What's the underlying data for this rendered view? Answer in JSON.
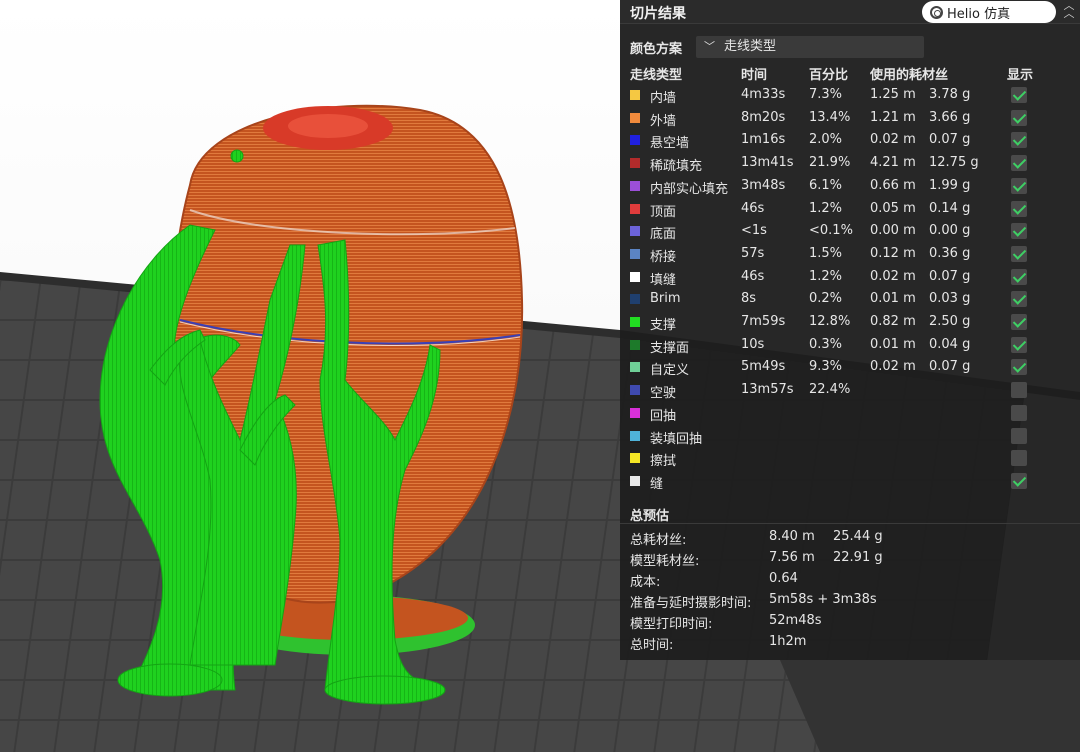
{
  "panel": {
    "title": "切片结果",
    "helio_button": "Helio 仿真",
    "color_scheme_label": "颜色方案",
    "color_scheme_value": "走线类型",
    "headers": {
      "type": "走线类型",
      "time": "时间",
      "percent": "百分比",
      "usage": "使用的耗材丝",
      "show": "显示"
    }
  },
  "legend": [
    {
      "name": "内墙",
      "color": "#f5c842",
      "time": "4m33s",
      "percent": "7.3%",
      "length": "1.25 m",
      "weight": "3.78 g",
      "checked": true
    },
    {
      "name": "外墙",
      "color": "#f08a3c",
      "time": "8m20s",
      "percent": "13.4%",
      "length": "1.21 m",
      "weight": "3.66 g",
      "checked": true
    },
    {
      "name": "悬空墙",
      "color": "#2020e0",
      "time": "1m16s",
      "percent": "2.0%",
      "length": "0.02 m",
      "weight": "0.07 g",
      "checked": true
    },
    {
      "name": "稀疏填充",
      "color": "#b22b2b",
      "time": "13m41s",
      "percent": "21.9%",
      "length": "4.21 m",
      "weight": "12.75 g",
      "checked": true
    },
    {
      "name": "内部实心填充",
      "color": "#9b4fd8",
      "time": "3m48s",
      "percent": "6.1%",
      "length": "0.66 m",
      "weight": "1.99 g",
      "checked": true
    },
    {
      "name": "顶面",
      "color": "#e03c3c",
      "time": "46s",
      "percent": "1.2%",
      "length": "0.05 m",
      "weight": "0.14 g",
      "checked": true
    },
    {
      "name": "底面",
      "color": "#6c63d9",
      "time": "<1s",
      "percent": "<0.1%",
      "length": "0.00 m",
      "weight": "0.00 g",
      "checked": true
    },
    {
      "name": "桥接",
      "color": "#5b84c4",
      "time": "57s",
      "percent": "1.5%",
      "length": "0.12 m",
      "weight": "0.36 g",
      "checked": true
    },
    {
      "name": "填缝",
      "color": "#ffffff",
      "time": "46s",
      "percent": "1.2%",
      "length": "0.02 m",
      "weight": "0.07 g",
      "checked": true
    },
    {
      "name": "Brim",
      "color": "#1f3f6e",
      "time": "8s",
      "percent": "0.2%",
      "length": "0.01 m",
      "weight": "0.03 g",
      "checked": true
    },
    {
      "name": "支撑",
      "color": "#22dd22",
      "time": "7m59s",
      "percent": "12.8%",
      "length": "0.82 m",
      "weight": "2.50 g",
      "checked": true
    },
    {
      "name": "支撑面",
      "color": "#1d7a2a",
      "time": "10s",
      "percent": "0.3%",
      "length": "0.01 m",
      "weight": "0.04 g",
      "checked": true
    },
    {
      "name": "自定义",
      "color": "#6fcf97",
      "time": "5m49s",
      "percent": "9.3%",
      "length": "0.02 m",
      "weight": "0.07 g",
      "checked": true
    },
    {
      "name": "空驶",
      "color": "#3f4ab0",
      "time": "13m57s",
      "percent": "22.4%",
      "length": "",
      "weight": "",
      "checked": false
    },
    {
      "name": "回抽",
      "color": "#d930d9",
      "time": "",
      "percent": "",
      "length": "",
      "weight": "",
      "checked": false
    },
    {
      "name": "装填回抽",
      "color": "#4fb3d9",
      "time": "",
      "percent": "",
      "length": "",
      "weight": "",
      "checked": false
    },
    {
      "name": "擦拭",
      "color": "#f5e625",
      "time": "",
      "percent": "",
      "length": "",
      "weight": "",
      "checked": false
    },
    {
      "name": "缝",
      "color": "#e8e8e8",
      "time": "",
      "percent": "",
      "length": "",
      "weight": "",
      "checked": true
    }
  ],
  "summary": {
    "title": "总预估",
    "rows": [
      {
        "label": "总耗材丝:",
        "v1": "8.40 m",
        "v2": "25.44 g"
      },
      {
        "label": "模型耗材丝:",
        "v1": "7.56 m",
        "v2": "22.91 g"
      },
      {
        "label": "成本:",
        "v1": "0.64",
        "v2": ""
      },
      {
        "label": "准备与延时摄影时间:",
        "v1": "5m58s + 3m38s",
        "v2": ""
      },
      {
        "label": "模型打印时间:",
        "v1": "52m48s",
        "v2": ""
      },
      {
        "label": "总时间:",
        "v1": "1h2m",
        "v2": ""
      }
    ]
  },
  "icons": {
    "helio": "helio-swirl-icon",
    "collapse": "double-chevron-up-icon",
    "scheme_dropdown": "chevron-down-icon",
    "check": "check-icon"
  }
}
